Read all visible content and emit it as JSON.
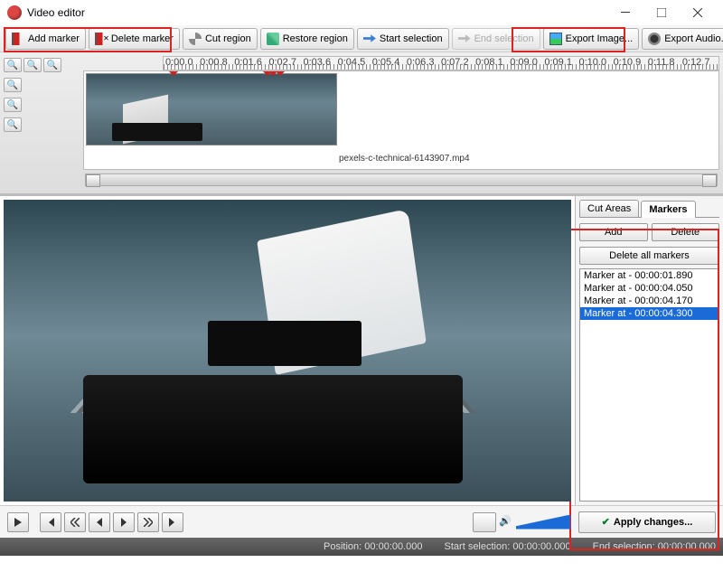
{
  "window": {
    "title": "Video editor"
  },
  "toolbar": {
    "add_marker": "Add marker",
    "delete_marker": "Delete marker",
    "cut_region": "Cut region",
    "restore_region": "Restore region",
    "start_selection": "Start selection",
    "end_selection": "End selection",
    "export_image": "Export Image...",
    "export_audio": "Export Audio..."
  },
  "timeline": {
    "ticks": [
      "0:00.0",
      "0:00.8",
      "0:01.6",
      "0:02.7",
      "0:03.6",
      "0:04.5",
      "0:05.4",
      "0:06.3",
      "0:07.2",
      "0:08.1",
      "0:09.0",
      "0:09.1",
      "0:10.0",
      "0:10.9",
      "0:11.8",
      "0:12.7"
    ],
    "filename": "pexels-c-technical-6143907.mp4"
  },
  "side": {
    "tab_cut": "Cut Areas",
    "tab_markers": "Markers",
    "add": "Add",
    "delete": "Delete",
    "delete_all": "Delete all markers",
    "markers": [
      "Marker at - 00:00:01.890",
      "Marker at - 00:00:04.050",
      "Marker at - 00:00:04.170",
      "Marker at - 00:00:04.300"
    ],
    "selected_index": 3,
    "apply": "Apply changes..."
  },
  "status": {
    "position_label": "Position:",
    "position_value": "00:00:00.000",
    "start_label": "Start selection:",
    "start_value": "00:00:00.000",
    "end_label": "End selection:",
    "end_value": "00:00:00.000"
  }
}
